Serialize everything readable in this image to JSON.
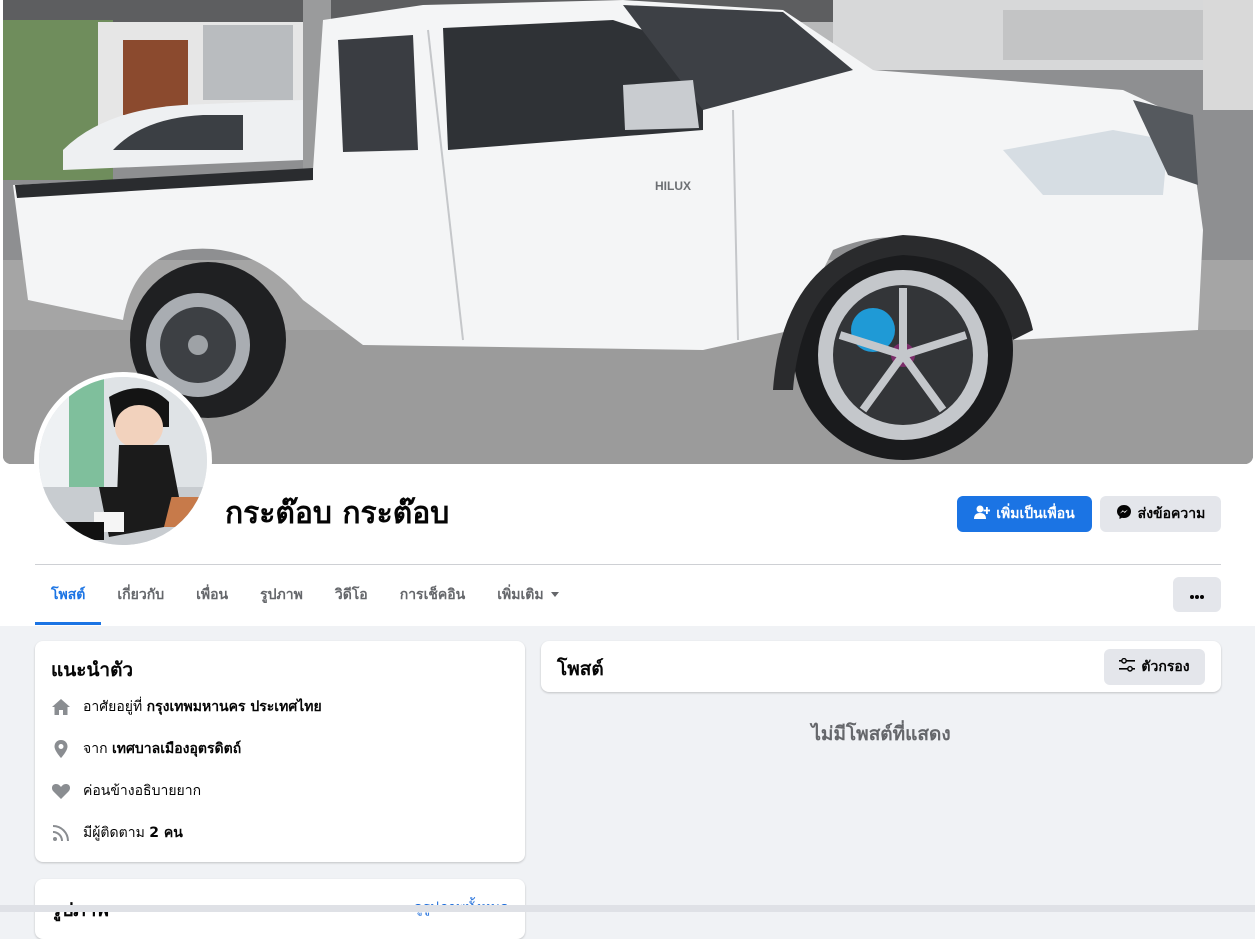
{
  "profile": {
    "name": "กระต๊อบ กระต๊อบ",
    "add_friend_label": "เพิ่มเป็นเพื่อน",
    "message_label": "ส่งข้อความ"
  },
  "tabs": [
    {
      "label": "โพสต์",
      "active": true
    },
    {
      "label": "เกี่ยวกับ"
    },
    {
      "label": "เพื่อน"
    },
    {
      "label": "รูปภาพ"
    },
    {
      "label": "วิดีโอ"
    },
    {
      "label": "การเช็คอิน"
    },
    {
      "label": "เพิ่มเติม"
    }
  ],
  "intro": {
    "title": "แนะนำตัว",
    "lives_prefix": "อาศัยอยู่ที่",
    "lives_value": "กรุงเทพมหานคร ประเทศไทย",
    "from_prefix": "จาก",
    "from_value": "เทศบาลเมืองอุตรดิตถ์",
    "relationship": "ค่อนข้างอธิบายยาก",
    "followers_prefix": "มีผู้ติดตาม",
    "followers_value": "2 คน"
  },
  "photos": {
    "title": "รูปภาพ",
    "see_all": "ดูรูปภาพทั้งหมด"
  },
  "posts": {
    "title": "โพสต์",
    "filter_label": "ตัวกรอง",
    "empty_message": "ไม่มีโพสต์ที่แสดง"
  },
  "cover": {
    "badge_text": "HILUX"
  },
  "colors": {
    "accent": "#1b74e4",
    "background": "#f0f2f5",
    "secondary_button": "#e4e6eb",
    "muted_text": "#65676b"
  }
}
